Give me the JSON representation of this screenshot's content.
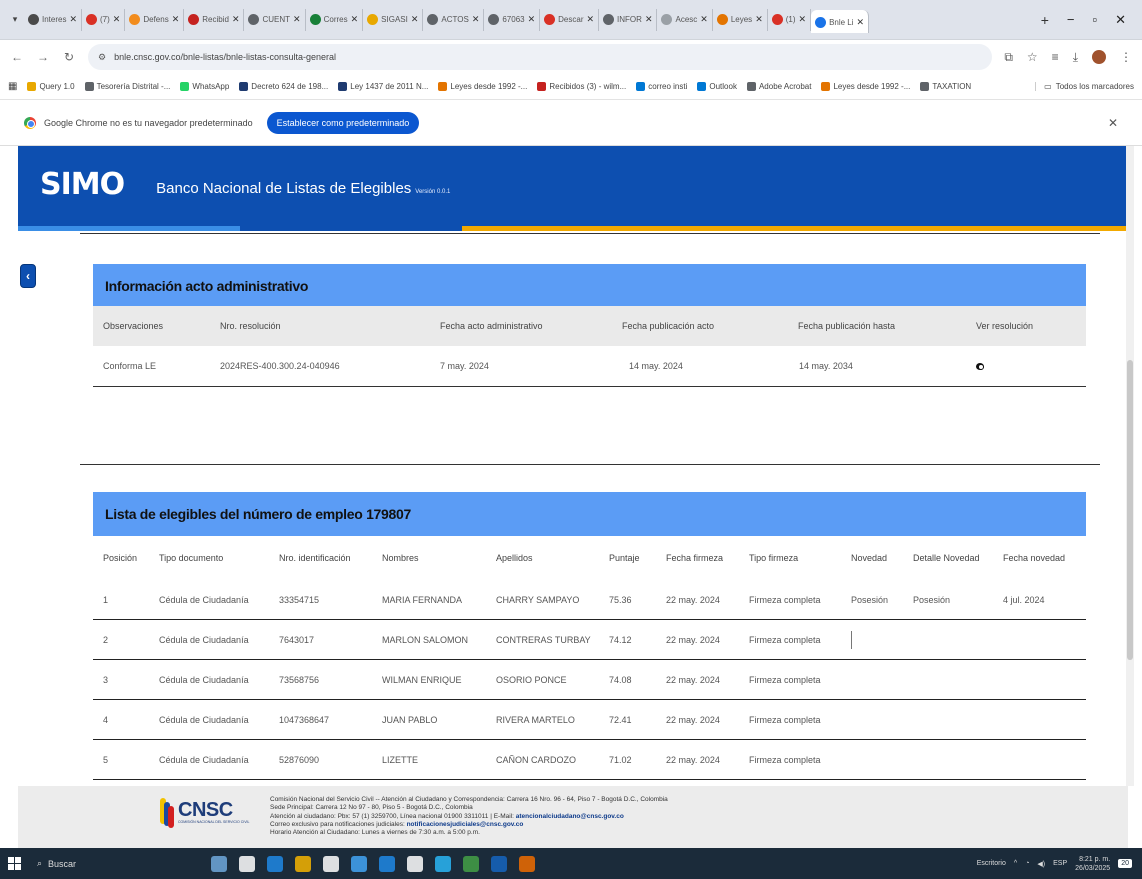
{
  "browser": {
    "tabs": [
      {
        "label": "Interes",
        "color": "#4a4a4a"
      },
      {
        "label": "(7)",
        "color": "#d93025"
      },
      {
        "label": "Defens",
        "color": "#f28c1d"
      },
      {
        "label": "Recibid",
        "color": "#c5221f"
      },
      {
        "label": "CUENT",
        "color": "#5f6368"
      },
      {
        "label": "Corres",
        "color": "#188038"
      },
      {
        "label": "SIGASI",
        "color": "#e8a800"
      },
      {
        "label": "ACTOS",
        "color": "#5f6368"
      },
      {
        "label": "67063",
        "color": "#5f6368"
      },
      {
        "label": "Descar",
        "color": "#d93025"
      },
      {
        "label": "INFOR",
        "color": "#5f6368"
      },
      {
        "label": "Acesc",
        "color": "#9aa0a6"
      },
      {
        "label": "Leyes",
        "color": "#e37400"
      },
      {
        "label": "(1)",
        "color": "#d93025"
      },
      {
        "label": "Bnle Li",
        "color": "#1a73e8",
        "active": true
      }
    ],
    "new_tab": "+",
    "window_controls": [
      "−",
      "▫",
      "✕"
    ],
    "url": "bnle.cnsc.gov.co/bnle-listas/bnle-listas-consulta-general",
    "bookmarks": [
      {
        "label": "Query 1.0",
        "color": "#e8a800"
      },
      {
        "label": "Tesorería Distrital -...",
        "color": "#5f6368"
      },
      {
        "label": "WhatsApp",
        "color": "#25d366"
      },
      {
        "label": "Decreto 624 de 198...",
        "color": "#1f3b70"
      },
      {
        "label": "Ley 1437 de 2011 N...",
        "color": "#1f3b70"
      },
      {
        "label": "Leyes desde 1992 -...",
        "color": "#e37400"
      },
      {
        "label": "Recibidos (3) - wilm...",
        "color": "#c5221f"
      },
      {
        "label": "correo insti",
        "color": "#0078d4"
      },
      {
        "label": "Outlook",
        "color": "#0078d4"
      },
      {
        "label": "Adobe Acrobat",
        "color": "#5f6368"
      },
      {
        "label": "Leyes desde 1992 -...",
        "color": "#e37400"
      },
      {
        "label": "TAXATION",
        "color": "#5f6368"
      }
    ],
    "all_bookmarks": "Todos los marcadores",
    "infobar_text": "Google Chrome no es tu navegador predeterminado",
    "infobar_button": "Establecer como predeterminado",
    "infobar_close": "✕"
  },
  "header": {
    "logo": "SIMO",
    "title": "Banco Nacional de Listas de Elegibles",
    "version": "Versión 0.0.1",
    "collapse_icon": "‹"
  },
  "acto": {
    "heading": "Información acto administrativo",
    "columns": [
      "Observaciones",
      "Nro. resolución",
      "Fecha acto administrativo",
      "Fecha publicación acto",
      "Fecha publicación hasta",
      "Ver resolución"
    ],
    "row": {
      "observaciones": "Conforma LE",
      "resolucion": "2024RES-400.300.24-040946",
      "fecha_acto": "7 may. 2024",
      "fecha_pub": "14 may. 2024",
      "fecha_hasta": "14 may. 2034"
    }
  },
  "lista": {
    "heading": "Lista de elegibles del número de empleo 179807",
    "columns": [
      "Posición",
      "Tipo documento",
      "Nro. identificación",
      "Nombres",
      "Apellidos",
      "Puntaje",
      "Fecha firmeza",
      "Tipo firmeza",
      "Novedad",
      "Detalle Novedad",
      "Fecha novedad"
    ],
    "rows": [
      {
        "pos": "1",
        "tipo": "Cédula de Ciudadanía",
        "id": "33354715",
        "nombres": "MARIA FERNANDA",
        "apellidos": "CHARRY SAMPAYO",
        "puntaje": "75.36",
        "fecha": "22 may. 2024",
        "firmeza": "Firmeza completa",
        "novedad": "Posesión",
        "detalle": "Posesión",
        "fecha_nov": "4 jul. 2024"
      },
      {
        "pos": "2",
        "tipo": "Cédula de Ciudadanía",
        "id": "7643017",
        "nombres": "MARLON SALOMON",
        "apellidos": "CONTRERAS TURBAY",
        "puntaje": "74.12",
        "fecha": "22 may. 2024",
        "firmeza": "Firmeza completa",
        "novedad": "",
        "detalle": "",
        "fecha_nov": ""
      },
      {
        "pos": "3",
        "tipo": "Cédula de Ciudadanía",
        "id": "73568756",
        "nombres": "WILMAN ENRIQUE",
        "apellidos": "OSORIO PONCE",
        "puntaje": "74.08",
        "fecha": "22 may. 2024",
        "firmeza": "Firmeza completa",
        "novedad": "",
        "detalle": "",
        "fecha_nov": ""
      },
      {
        "pos": "4",
        "tipo": "Cédula de Ciudadanía",
        "id": "1047368647",
        "nombres": "JUAN PABLO",
        "apellidos": "RIVERA MARTELO",
        "puntaje": "72.41",
        "fecha": "22 may. 2024",
        "firmeza": "Firmeza completa",
        "novedad": "",
        "detalle": "",
        "fecha_nov": ""
      },
      {
        "pos": "5",
        "tipo": "Cédula de Ciudadanía",
        "id": "52876090",
        "nombres": "LIZETTE",
        "apellidos": "CAÑON CARDOZO",
        "puntaje": "71.02",
        "fecha": "22 may. 2024",
        "firmeza": "Firmeza completa",
        "novedad": "",
        "detalle": "",
        "fecha_nov": ""
      }
    ]
  },
  "footer": {
    "logo": "CNSC",
    "logo_sub": "COMISIÓN NACIONAL DEL SERVICIO CIVIL",
    "line1": "Comisión Nacional del Servicio Civil -- Atención al Ciudadano y Correspondencia: Carrera 16 Nro. 96 - 64, Piso 7 - Bogotá D.C., Colombia",
    "line2": "Sede Principal: Carrera 12 No 97 - 80, Piso 5 - Bogotá D.C., Colombia",
    "line3_a": "Atención al ciudadano: Pbx: 57 (1) 3259700, Línea nacional 01900 3311011 | E-Mail:",
    "line3_b": "atencionalciudadano@cnsc.gov.co",
    "line4_a": "Correo exclusivo para notificaciones judiciales:",
    "line4_b": "notificacionesjudiciales@cnsc.gov.co",
    "line5": "Horario Atención al Ciudadano: Lunes a viernes de 7:30 a.m. a 5:00 p.m."
  },
  "taskbar": {
    "search": "Buscar",
    "tray_lang": "ESP",
    "time": "8:21 p. m.",
    "date": "26/03/2025",
    "desktop_label": "Escritorio",
    "notif_count": "20",
    "apps": [
      "#6fa8dc",
      "#ffffff",
      "#1e88e5",
      "#f4b400",
      "#ffffff",
      "#42a5f5",
      "#1e88e5",
      "#ffffff",
      "#29b6f6",
      "#43a047",
      "#1565c0",
      "#ef6c00"
    ]
  }
}
